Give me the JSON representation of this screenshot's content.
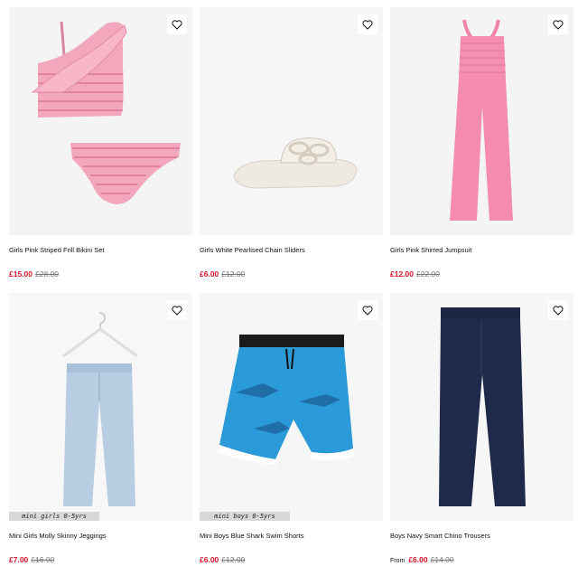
{
  "products": [
    {
      "title": "Girls Pink Striped Frill Bikini Set",
      "price_now": "£15.00",
      "price_was": "£28.00",
      "badge": "",
      "from": "",
      "image_icon": "bikini-set"
    },
    {
      "title": "Girls White Pearlised Chain Sliders",
      "price_now": "£6.00",
      "price_was": "£12.00",
      "badge": "",
      "from": "",
      "image_icon": "slider-sandal"
    },
    {
      "title": "Girls Pink Shirred Jumpsuit",
      "price_now": "£12.00",
      "price_was": "£22.00",
      "badge": "",
      "from": "",
      "image_icon": "jumpsuit"
    },
    {
      "title": "Mini Girls Molly Skinny Jeggings",
      "price_now": "£7.00",
      "price_was": "£16.00",
      "badge": "mini girls 0-5yrs",
      "from": "",
      "image_icon": "jeans-on-hanger"
    },
    {
      "title": "Mini Boys Blue Shark Swim Shorts",
      "price_now": "£6.00",
      "price_was": "£12.00",
      "badge": "mini boys 0-5yrs",
      "from": "",
      "image_icon": "swim-shorts"
    },
    {
      "title": "Boys Navy Smart Chino Trousers",
      "price_now": "£6.00",
      "price_was": "£14.00",
      "badge": "",
      "from": "From",
      "image_icon": "chino-trousers"
    }
  ],
  "colors": {
    "sale": "#d6122a",
    "image_bg": "#f3f3f3",
    "badge_bg": "#d8d8d8"
  }
}
